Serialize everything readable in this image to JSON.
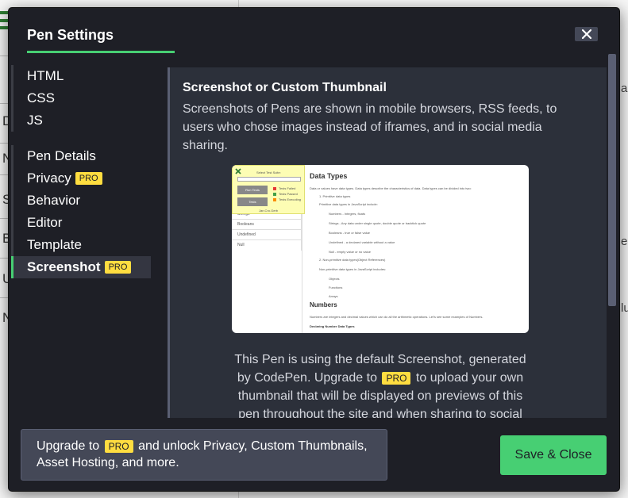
{
  "modal": {
    "title": "Pen Settings",
    "close_label": "✕",
    "nav": {
      "group1": [
        {
          "label": "HTML"
        },
        {
          "label": "CSS"
        },
        {
          "label": "JS"
        }
      ],
      "group2": [
        {
          "label": "Pen Details"
        },
        {
          "label": "Privacy",
          "badge": "PRO"
        },
        {
          "label": "Behavior"
        },
        {
          "label": "Editor"
        },
        {
          "label": "Template"
        },
        {
          "label": "Screenshot",
          "badge": "PRO",
          "active": true
        }
      ]
    },
    "content": {
      "title": "Screenshot or Custom Thumbnail",
      "description": "Screenshots of Pens are shown in mobile browsers, RSS feeds, to users who chose images instead of iframes, and in social media sharing.",
      "note_part1": "This Pen is using the default Screenshot, generated by CodePen. Upgrade to",
      "note_badge": "PRO",
      "note_part2": "to upload your own thumbnail that will be displayed on previews of this pen throughout the site and when sharing to social",
      "thumbnail": {
        "doc_title": "Data Types",
        "line1": "Data or values have data types. Data types describe the characteristics of data. Data types can be divided into two:",
        "line2": "1. Primitive data types",
        "line3": "Primitive data types in JavaScript include:",
        "line4": "Numbers - Integers, floats",
        "line5": "Strings - Any data under single quote, double quote or backtick quote",
        "line6": "Booleans - true or false value",
        "line7": "Undefined - a declared variable without a value",
        "line8": "Null - empty value or no value",
        "line9": "2. Non-primitive data types(Object References)",
        "line10": "Non-primitive data types in JavaScript includes:",
        "line11": "Objects",
        "line12": "Functions",
        "line13": "Arrays",
        "section2": "Numbers",
        "line14": "Numbers are integers and decimal values which can do all the arithmetic operations. Let's see some examples of Numbers.",
        "line15": "Declaring Number Data Types",
        "nav_items": [
          "Strings",
          "Booleans",
          "Undefined",
          "Null"
        ],
        "sticky_title": "Select Test Suite:",
        "run_button": "Run Tests",
        "tests_button": "Tests",
        "legend_failed": "Tests Failed",
        "legend_passed": "Tests Passed",
        "legend_executing": "Tests Executing",
        "sticky_footer": "Jan.Cro.Gerb"
      }
    },
    "footer": {
      "upgrade_prefix": "Upgrade to",
      "upgrade_badge": "PRO",
      "upgrade_suffix": "and unlock Privacy, Custom Thumbnails, Asset Hosting, and more.",
      "save_label": "Save & Close"
    }
  },
  "background": {
    "left_letters": [
      "D",
      "N",
      "S",
      "B",
      "U",
      "N"
    ],
    "right_letters": [
      "a",
      "e",
      "lu"
    ]
  },
  "colors": {
    "accent_green": "#47cf73",
    "pro_yellow": "#ffdd40",
    "modal_bg": "#1e1f26",
    "panel_bg": "#2c303a"
  }
}
